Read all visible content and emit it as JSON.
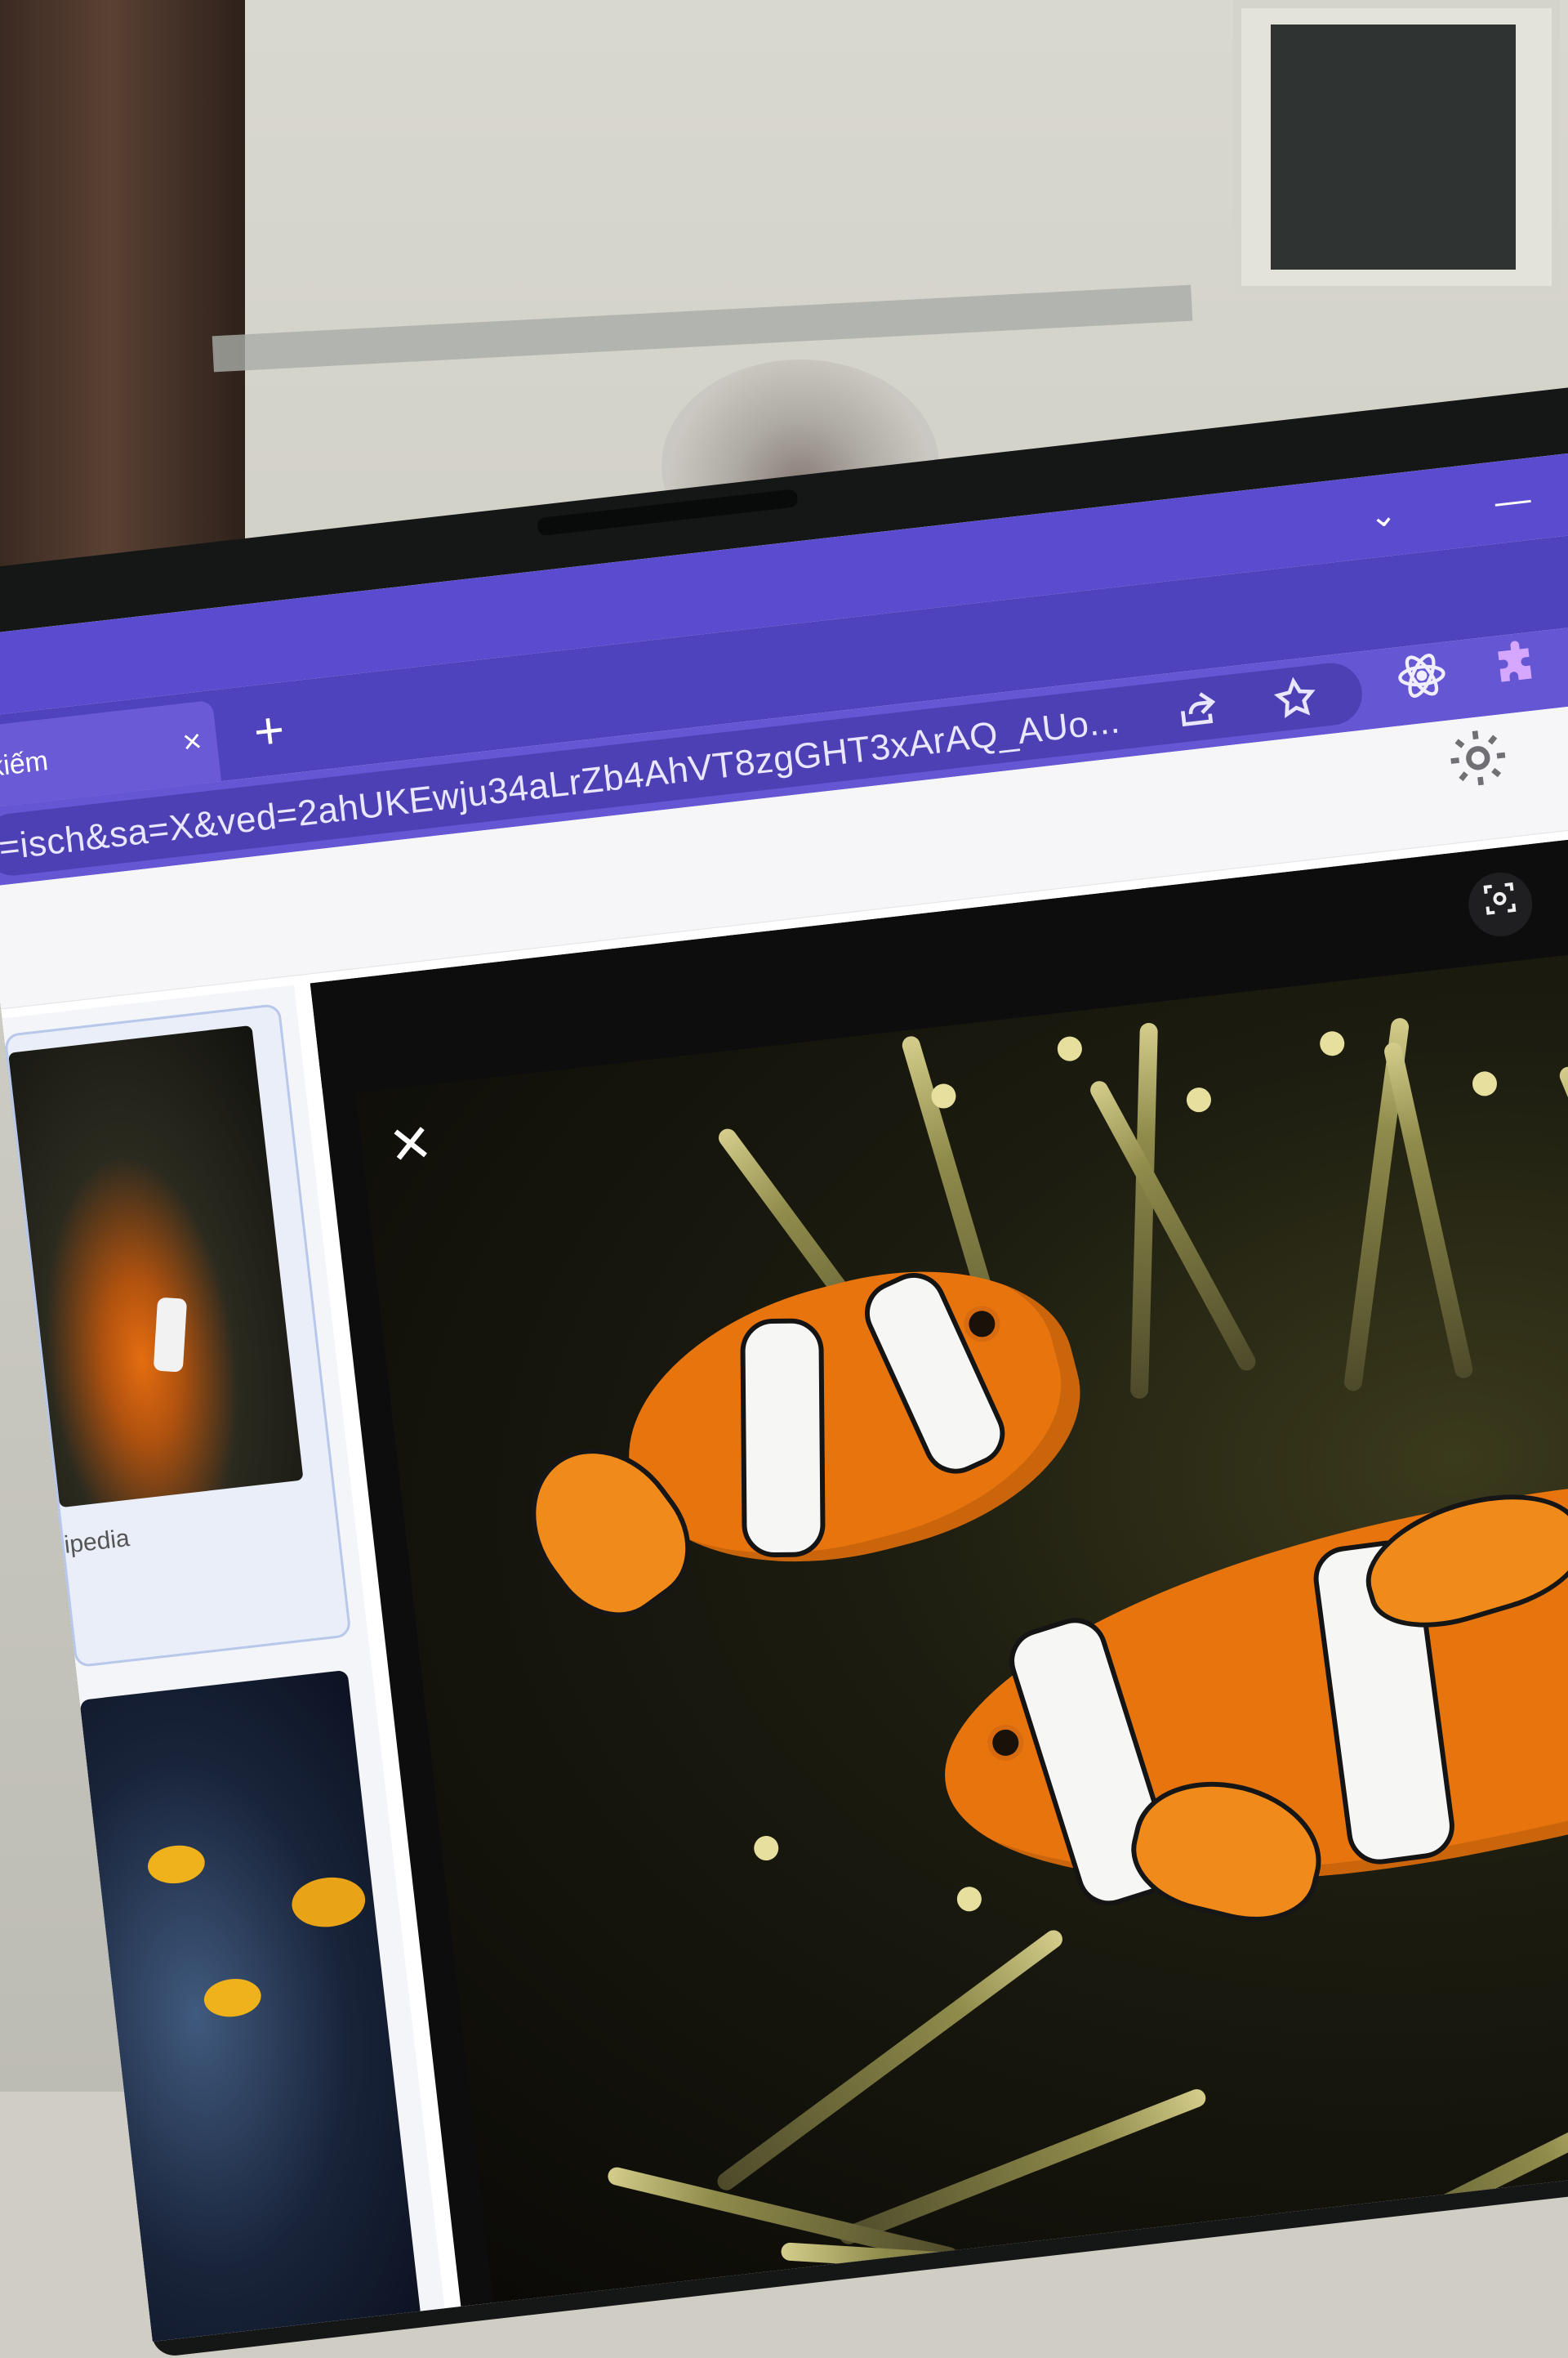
{
  "browser": {
    "tab": {
      "title": "kiếm",
      "close_icon": "×"
    },
    "new_tab_icon": "+",
    "address": "=isch&sa=X&ved=2ahUKEwju34aLrZb4AhVT8zgGHT3xArAQ_AUo...",
    "tab_strip_chevron": "⌄",
    "minimize_icon": "—"
  },
  "toolbar": {
    "share_icon": "share-icon",
    "bookmark_icon": "star-icon",
    "extension_atom_icon": "atom-icon",
    "extensions_icon": "puzzle-icon"
  },
  "page": {
    "settings_icon": "gear-icon",
    "results": [
      {
        "source": "ipedia"
      }
    ],
    "viewer": {
      "close_icon": "✕",
      "lens_icon": "lens-icon",
      "more_icon": "⋮",
      "prev_icon": "‹"
    }
  },
  "colors": {
    "browser_frame": "#5b4ccf",
    "omnibox": "#4d40b4",
    "viewer_bg": "#0d0d0e",
    "clownfish_orange": "#e8740e"
  }
}
